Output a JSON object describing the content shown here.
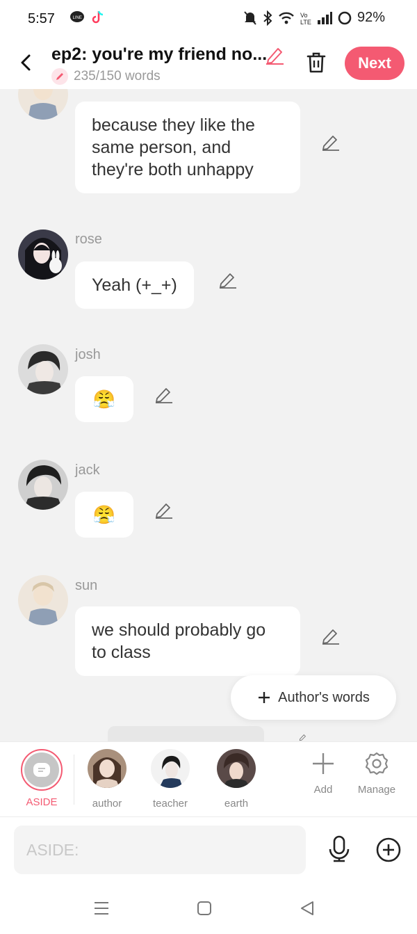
{
  "status_bar": {
    "time": "5:57",
    "battery": "92%",
    "left_icons": [
      "line-app-icon",
      "tiktok-icon"
    ],
    "right_icons": [
      "mute-icon",
      "bluetooth-icon",
      "wifi-icon",
      "volte-icon",
      "signal-icon",
      "battery-icon"
    ]
  },
  "header": {
    "title": "ep2: you're my friend no...",
    "word_count": "235/150 words",
    "next_label": "Next",
    "accent": "#f45a72"
  },
  "messages": [
    {
      "speaker": "",
      "text": "because they like the same person, and they're both unhappy",
      "avatar": "sun"
    },
    {
      "speaker": "rose",
      "text": "Yeah (+_+)",
      "avatar": "rose"
    },
    {
      "speaker": "josh",
      "text": "😤",
      "avatar": "josh"
    },
    {
      "speaker": "jack",
      "text": "😤",
      "avatar": "jack"
    },
    {
      "speaker": "sun",
      "text": "we should probably go to class",
      "avatar": "sun"
    }
  ],
  "authors_words": "Author's words",
  "characters": [
    {
      "label": "ASIDE",
      "selected": true
    },
    {
      "label": "author"
    },
    {
      "label": "teacher"
    },
    {
      "label": "earth"
    }
  ],
  "tools": {
    "add": "Add",
    "manage": "Manage"
  },
  "input": {
    "placeholder": "ASIDE:"
  }
}
